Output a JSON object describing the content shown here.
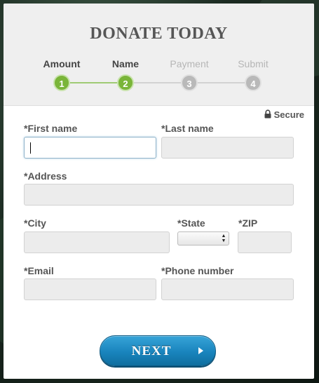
{
  "form": {
    "title": "DONATE TODAY",
    "steps": [
      {
        "label": "Amount",
        "number": "1",
        "state": "completed"
      },
      {
        "label": "Name",
        "number": "2",
        "state": "current"
      },
      {
        "label": "Payment",
        "number": "3",
        "state": "pending"
      },
      {
        "label": "Submit",
        "number": "4",
        "state": "pending"
      }
    ],
    "secure_label": "Secure",
    "fields": {
      "first_name": {
        "label": "*First name",
        "value": ""
      },
      "last_name": {
        "label": "*Last name",
        "value": ""
      },
      "address": {
        "label": "*Address",
        "value": ""
      },
      "city": {
        "label": "*City",
        "value": ""
      },
      "state": {
        "label": "*State",
        "value": ""
      },
      "zip": {
        "label": "*ZIP",
        "value": ""
      },
      "email": {
        "label": "*Email",
        "value": ""
      },
      "phone": {
        "label": "*Phone number",
        "value": ""
      }
    },
    "next_button": {
      "label": "NEXT"
    }
  },
  "colors": {
    "step_complete": "#7ab539",
    "step_pending": "#b9b9b9",
    "button": "#1984bd",
    "header_bg": "#efefef",
    "field_bg": "#ececec"
  },
  "icons": [
    "lock-icon",
    "chevron-right-icon",
    "select-arrows-icon"
  ]
}
